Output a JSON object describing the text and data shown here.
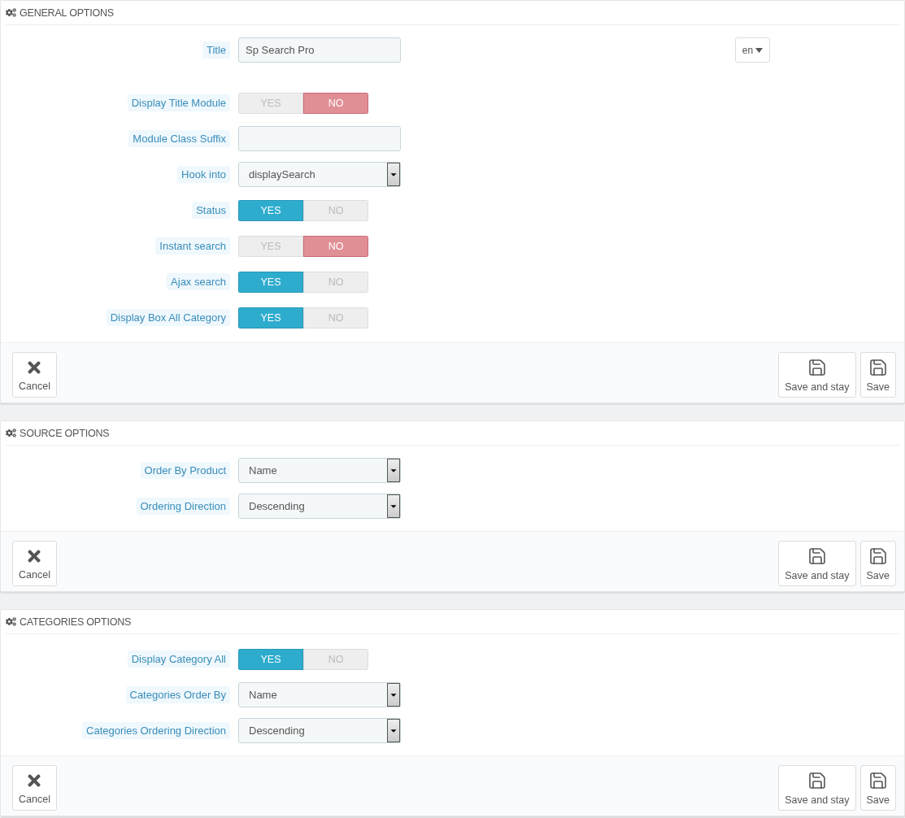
{
  "panels": [
    {
      "title": "GENERAL OPTIONS",
      "fields": [
        {
          "kind": "text",
          "label": "Title",
          "value": "Sp Search Pro",
          "language": "en"
        },
        {
          "kind": "switch",
          "label": "Display Title Module",
          "options": [
            {
              "kind": "yes",
              "label": "YES",
              "selected": false
            },
            {
              "kind": "no",
              "label": "NO",
              "selected": true
            }
          ]
        },
        {
          "kind": "text",
          "label": "Module Class Suffix"
        },
        {
          "kind": "select",
          "label": "Hook into",
          "value": "displaySearch"
        },
        {
          "kind": "switch",
          "label": "Status",
          "options": [
            {
              "kind": "yes",
              "label": "YES",
              "selected": true
            },
            {
              "kind": "no",
              "label": "NO",
              "selected": false
            }
          ]
        },
        {
          "kind": "switch",
          "label": "Instant search",
          "options": [
            {
              "kind": "yes",
              "label": "YES",
              "selected": false
            },
            {
              "kind": "no",
              "label": "NO",
              "selected": true
            }
          ]
        },
        {
          "kind": "switch",
          "label": "Ajax search",
          "options": [
            {
              "kind": "yes",
              "label": "YES",
              "selected": true
            },
            {
              "kind": "no",
              "label": "NO",
              "selected": false
            }
          ]
        },
        {
          "kind": "switch",
          "label": "Display Box All Category",
          "options": [
            {
              "kind": "yes",
              "label": "YES",
              "selected": true
            },
            {
              "kind": "no",
              "label": "NO",
              "selected": false
            }
          ]
        }
      ],
      "buttons": [
        {
          "kind": "cancel",
          "label": "Cancel"
        },
        {
          "kind": "save",
          "label": "Save and stay"
        },
        {
          "kind": "save",
          "label": "Save"
        }
      ]
    },
    {
      "title": "SOURCE OPTIONS",
      "fields": [
        {
          "kind": "select",
          "label": "Order By Product",
          "value": "Name"
        },
        {
          "kind": "select",
          "label": "Ordering Direction",
          "value": "Descending"
        }
      ],
      "buttons": [
        {
          "kind": "cancel",
          "label": "Cancel"
        },
        {
          "kind": "save",
          "label": "Save and stay"
        },
        {
          "kind": "save",
          "label": "Save"
        }
      ]
    },
    {
      "title": "CATEGORIES OPTIONS",
      "fields": [
        {
          "kind": "switch",
          "label": "Display Category All",
          "options": [
            {
              "kind": "yes",
              "label": "YES",
              "selected": true
            },
            {
              "kind": "no",
              "label": "NO",
              "selected": false
            }
          ]
        },
        {
          "kind": "select",
          "label": "Categories Order By",
          "value": "Name"
        },
        {
          "kind": "select",
          "label": "Categories Ordering Direction",
          "value": "Descending"
        }
      ],
      "buttons": [
        {
          "kind": "cancel",
          "label": "Cancel"
        },
        {
          "kind": "save",
          "label": "Save and stay"
        },
        {
          "kind": "save",
          "label": "Save"
        }
      ]
    }
  ]
}
